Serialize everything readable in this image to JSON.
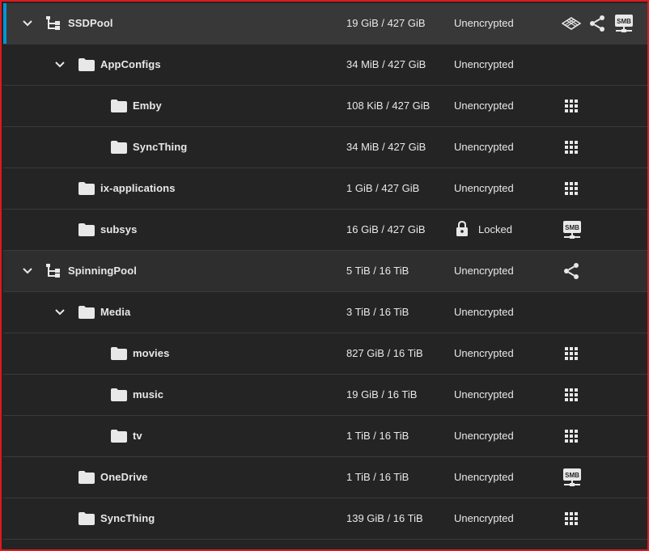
{
  "datasets": [
    {
      "name": "SSDPool",
      "used": "19 GiB / 427 GiB",
      "encryption": "Unencrypted",
      "roles": [
        "layers-icon",
        "share-icon",
        "smb-icon"
      ],
      "smb_label": "SMB"
    },
    {
      "name": "AppConfigs",
      "used": "34 MiB / 427 GiB",
      "encryption": "Unencrypted",
      "roles": []
    },
    {
      "name": "Emby",
      "used": "108 KiB / 427 GiB",
      "encryption": "Unencrypted",
      "roles": [
        "apps-icon"
      ]
    },
    {
      "name": "SyncThing",
      "used": "34 MiB / 427 GiB",
      "encryption": "Unencrypted",
      "roles": [
        "apps-icon"
      ]
    },
    {
      "name": "ix-applications",
      "used": "1 GiB / 427 GiB",
      "encryption": "Unencrypted",
      "roles": [
        "apps-icon"
      ]
    },
    {
      "name": "subsys",
      "used": "16 GiB / 427 GiB",
      "encryption": "Locked",
      "roles": [
        "smb-icon"
      ],
      "smb_label": "SMB"
    },
    {
      "name": "SpinningPool",
      "used": "5 TiB / 16 TiB",
      "encryption": "Unencrypted",
      "roles": [
        "share-icon"
      ]
    },
    {
      "name": "Media",
      "used": "3 TiB / 16 TiB",
      "encryption": "Unencrypted",
      "roles": []
    },
    {
      "name": "movies",
      "used": "827 GiB / 16 TiB",
      "encryption": "Unencrypted",
      "roles": [
        "apps-icon"
      ]
    },
    {
      "name": "music",
      "used": "19 GiB / 16 TiB",
      "encryption": "Unencrypted",
      "roles": [
        "apps-icon"
      ]
    },
    {
      "name": "tv",
      "used": "1 TiB / 16 TiB",
      "encryption": "Unencrypted",
      "roles": [
        "apps-icon"
      ]
    },
    {
      "name": "OneDrive",
      "used": "1 TiB / 16 TiB",
      "encryption": "Unencrypted",
      "roles": [
        "smb-icon"
      ],
      "smb_label": "SMB"
    },
    {
      "name": "SyncThing",
      "used": "139 GiB / 16 TiB",
      "encryption": "Unencrypted",
      "roles": [
        "apps-icon"
      ]
    }
  ],
  "colors": {
    "accent": "#0095d5",
    "frame_border": "#e0191f",
    "background": "#242424",
    "text": "#e8e8e8"
  }
}
